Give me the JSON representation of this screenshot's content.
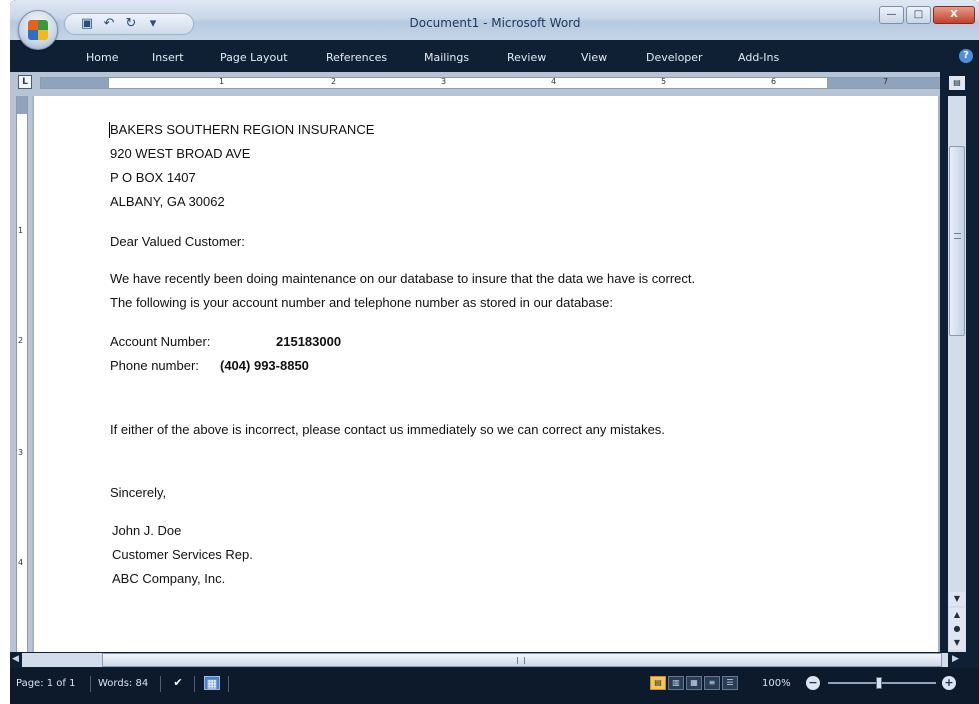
{
  "window": {
    "title": "Document1 - Microsoft Word",
    "controls": {
      "minimize": "—",
      "maximize": "□",
      "close": "X"
    }
  },
  "quick_access": [
    {
      "icon": "save-icon",
      "glyph": "▣"
    },
    {
      "icon": "undo-icon",
      "glyph": "↶"
    },
    {
      "icon": "redo-icon",
      "glyph": "↻"
    },
    {
      "icon": "customize-icon",
      "glyph": "▾"
    }
  ],
  "ribbon_tabs": [
    "Home",
    "Insert",
    "Page Layout",
    "References",
    "Mailings",
    "Review",
    "View",
    "Developer",
    "Add-Ins"
  ],
  "ruler": {
    "tab_selector": "L",
    "numbers": [
      "1",
      "2",
      "3",
      "4",
      "5",
      "6",
      "7"
    ],
    "vertical_numbers": [
      "1",
      "2",
      "3",
      "4"
    ]
  },
  "document": {
    "address": [
      "BAKERS SOUTHERN REGION INSURANCE",
      "920 WEST BROAD AVE",
      "P O BOX 1407",
      "ALBANY, GA 30062"
    ],
    "salutation": "Dear Valued Customer:",
    "intro": [
      "We have recently been doing maintenance on our database to insure that the data we have is correct.",
      "The following is your account number and telephone number as stored in our database:"
    ],
    "account_label": "Account Number:",
    "account_value": "215183000",
    "phone_label": "Phone number:",
    "phone_value": "(404) 993-8850",
    "notice": "If either of the above is incorrect, please contact us immediately so we can correct any mistakes.",
    "closing": "Sincerely,",
    "signature": [
      "John J. Doe",
      "Customer Services Rep.",
      "ABC Company, Inc."
    ]
  },
  "status_bar": {
    "page": "Page: 1 of 1",
    "words": "Words: 84",
    "zoom": "100%"
  },
  "colors": {
    "title_bar": "#c9d7e8",
    "ribbon_dark": "#0f2035",
    "page_bg": "#a3b4cb",
    "close_button": "#c3422a",
    "active_view": "#f1c65a"
  }
}
